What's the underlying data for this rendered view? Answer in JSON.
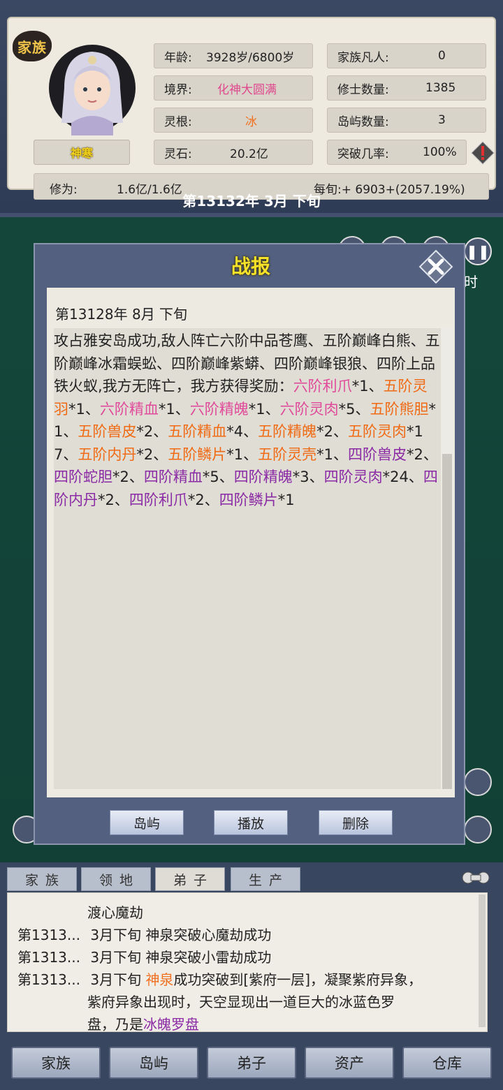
{
  "header": {
    "badge": "家族",
    "character_name": "神寒",
    "stats": {
      "age_label": "年龄:",
      "age_value": "3928岁/6800岁",
      "realm_label": "境界:",
      "realm_value": "化神大圆满",
      "root_label": "灵根:",
      "root_value": "冰",
      "stone_label": "灵石:",
      "stone_value": "20.2亿",
      "mortals_label": "家族凡人:",
      "mortals_value": "0",
      "cultivators_label": "修士数量:",
      "cultivators_value": "1385",
      "islands_label": "岛屿数量:",
      "islands_value": "3",
      "breakthrough_label": "突破几率:",
      "breakthrough_value": "100%"
    },
    "cultivation_label": "修为:",
    "cultivation_value": "1.6亿/1.6亿",
    "per_period": "每旬:+ 6903+(2057.19%)",
    "current_date": "第13132年 3月 下旬",
    "colors": {
      "realm": "#e0478c",
      "root": "#f07020",
      "name": "#f2d21a"
    }
  },
  "map": {
    "time_label": "时"
  },
  "modal": {
    "title": "战报",
    "date": "第13128年 8月 下旬",
    "text_segments": [
      {
        "t": "攻占雅安岛成功,敌人阵亡六阶中品苍鹰、五阶巅峰白熊、五阶巅峰冰霜蜈蚣、四阶巅峰紫蟒、四阶巅峰银狼、四阶上品铁火蚁,我方无阵亡，我方获得奖励：",
        "c": ""
      },
      {
        "t": "六阶利爪",
        "c": "pink"
      },
      {
        "t": "*1、",
        "c": ""
      },
      {
        "t": "五阶灵羽",
        "c": "orange"
      },
      {
        "t": "*1、",
        "c": ""
      },
      {
        "t": "六阶精血",
        "c": "pink"
      },
      {
        "t": "*1、",
        "c": ""
      },
      {
        "t": "六阶精魄",
        "c": "pink"
      },
      {
        "t": "*1、",
        "c": ""
      },
      {
        "t": "六阶灵肉",
        "c": "pink"
      },
      {
        "t": "*5、",
        "c": ""
      },
      {
        "t": "五阶熊胆",
        "c": "orange"
      },
      {
        "t": "*1、",
        "c": ""
      },
      {
        "t": "五阶兽皮",
        "c": "orange"
      },
      {
        "t": "*2、",
        "c": ""
      },
      {
        "t": "五阶精血",
        "c": "orange"
      },
      {
        "t": "*4、",
        "c": ""
      },
      {
        "t": "五阶精魄",
        "c": "orange"
      },
      {
        "t": "*2、",
        "c": ""
      },
      {
        "t": "五阶灵肉",
        "c": "orange"
      },
      {
        "t": "*17、",
        "c": ""
      },
      {
        "t": "五阶内丹",
        "c": "orange"
      },
      {
        "t": "*2、",
        "c": ""
      },
      {
        "t": "五阶鳞片",
        "c": "orange"
      },
      {
        "t": "*1、",
        "c": ""
      },
      {
        "t": "五阶灵壳",
        "c": "orange"
      },
      {
        "t": "*1、",
        "c": ""
      },
      {
        "t": "四阶兽皮",
        "c": "purple"
      },
      {
        "t": "*2、",
        "c": ""
      },
      {
        "t": "四阶蛇胆",
        "c": "purple"
      },
      {
        "t": "*2、",
        "c": ""
      },
      {
        "t": "四阶精血",
        "c": "purple"
      },
      {
        "t": "*5、",
        "c": ""
      },
      {
        "t": "四阶精魄",
        "c": "purple"
      },
      {
        "t": "*3、",
        "c": ""
      },
      {
        "t": "四阶灵肉",
        "c": "purple"
      },
      {
        "t": "*24、",
        "c": ""
      },
      {
        "t": "四阶内丹",
        "c": "purple"
      },
      {
        "t": "*2、",
        "c": ""
      },
      {
        "t": "四阶利爪",
        "c": "purple"
      },
      {
        "t": "*2、",
        "c": ""
      },
      {
        "t": "四阶鳞片",
        "c": "purple"
      },
      {
        "t": "*1",
        "c": ""
      }
    ],
    "buttons": [
      "岛屿",
      "播放",
      "删除"
    ],
    "colors": {
      "pink": "#e04a9a",
      "orange": "#f06a14",
      "purple": "#8a2aa5",
      "title": "#f7e22a"
    }
  },
  "tabs": [
    "家族",
    "领地",
    "弟子",
    "生产"
  ],
  "active_tab": "弟子",
  "log": [
    {
      "date": "",
      "text": "渡心魔劫"
    },
    {
      "date": "第1313...",
      "text": "3月下旬 神泉突破心魔劫成功"
    },
    {
      "date": "第1313...",
      "text": "3月下旬 神泉突破小雷劫成功"
    },
    {
      "date": "第1313...",
      "text": "3月下旬 "
    }
  ],
  "log_last": {
    "name": "神泉",
    "rest": "成功突破到[紫府一层]，凝聚紫府异象，",
    "line2": "紫府异象出现时，天空显现出一道巨大的冰蓝色罗",
    "line3_a": "盘，乃是",
    "line3_b": "冰魄罗盘"
  },
  "nav": [
    "家族",
    "岛屿",
    "弟子",
    "资产",
    "仓库"
  ]
}
